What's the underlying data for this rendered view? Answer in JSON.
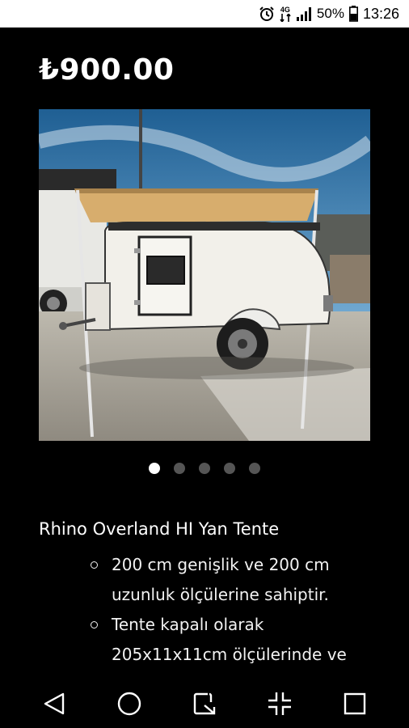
{
  "status_bar": {
    "alarm_icon": "alarm-icon",
    "network_badge": "4G",
    "signal_icon": "signal-icon",
    "battery_percent": "50%",
    "battery_icon": "battery-icon",
    "time": "13:26"
  },
  "product": {
    "price": "₺900.00",
    "carousel": {
      "total": 5,
      "active_index": 0
    },
    "title": "Rhino Overland HI Yan Tente",
    "bullets": [
      "200 cm genişlik ve 200 cm uzunluk ölçülerine sahiptir.",
      "Tente kapalı olarak 205x11x11cm ölçülerinde ve"
    ]
  },
  "nav_bar": {
    "back_icon": "back-icon",
    "home_icon": "home-icon",
    "screenshot_icon": "screenshot-icon",
    "fullscreen_icon": "fullscreen-icon",
    "recents_icon": "recents-icon"
  }
}
